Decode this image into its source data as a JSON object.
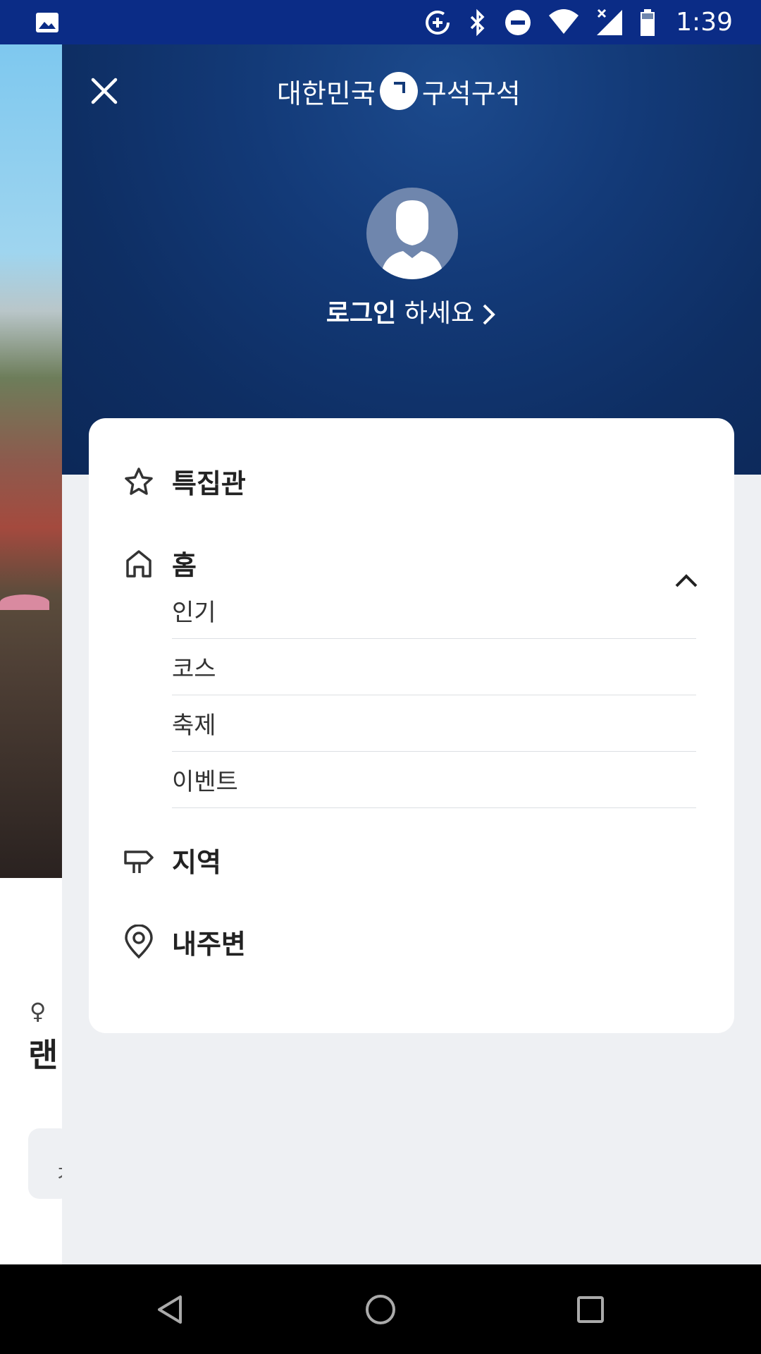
{
  "status_bar": {
    "time": "1:39",
    "icons": [
      "gallery-icon",
      "data-saver-icon",
      "bluetooth-icon",
      "do-not-disturb-icon",
      "wifi-icon",
      "signal-icon",
      "battery-icon"
    ]
  },
  "background_page": {
    "heading_fragment": "랜",
    "box_fragment": "ㅈ"
  },
  "drawer": {
    "logo_left": "대한민국",
    "logo_right": "구석구석",
    "login_bold": "로그인",
    "login_rest": " 하세요",
    "menu": [
      {
        "label": "특집관",
        "icon": "star-icon"
      },
      {
        "label": "홈",
        "icon": "home-icon"
      },
      {
        "label": "지역",
        "icon": "signpost-icon"
      },
      {
        "label": "내주변",
        "icon": "location-pin-icon"
      }
    ],
    "home_submenu": [
      "인기",
      "코스",
      "축제",
      "이벤트"
    ]
  },
  "colors": {
    "status_bar": "#0b2c86",
    "drawer_header": "#133a78",
    "drawer_bg": "#eef0f3",
    "card_bg": "#ffffff"
  }
}
